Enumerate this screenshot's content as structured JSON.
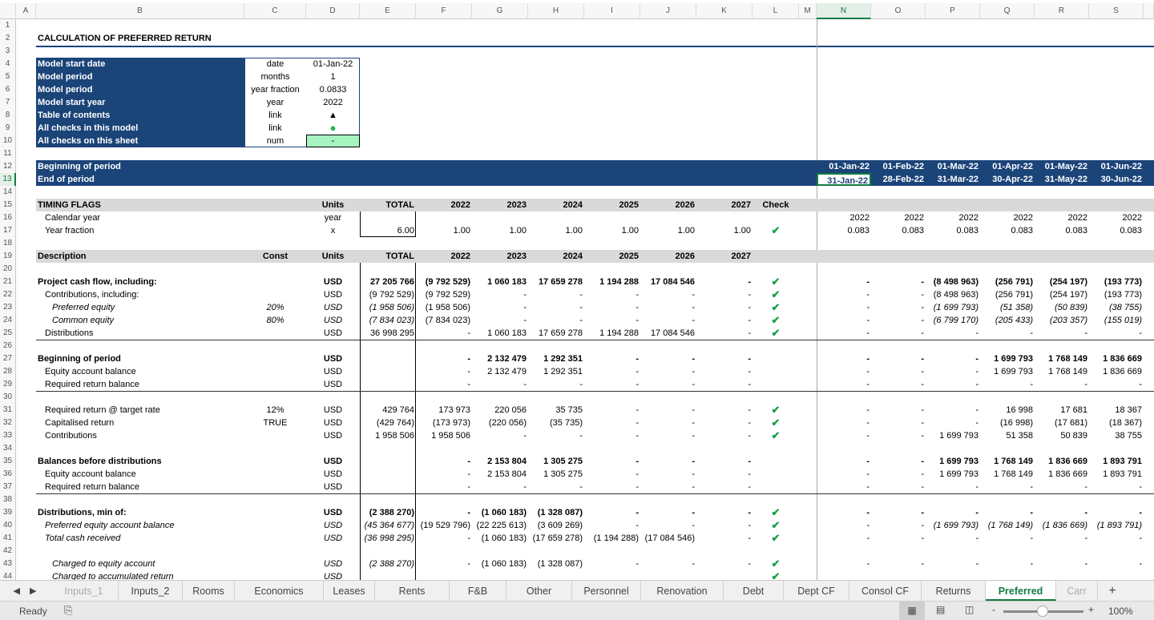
{
  "columns": [
    "A",
    "B",
    "C",
    "D",
    "E",
    "F",
    "G",
    "H",
    "I",
    "J",
    "K",
    "L",
    "M",
    "N",
    "O",
    "P",
    "Q",
    "R",
    "S"
  ],
  "selected_cell": "N13",
  "title": "CALCULATION OF PREFERRED RETURN",
  "rows": [
    {
      "r": 2,
      "cells": {
        "B": "CALCULATION OF PREFERRED RETURN"
      },
      "b": true
    },
    {
      "r": 4,
      "cells": {
        "B": "Model start date",
        "C": "date",
        "D": "01-Jan-22"
      },
      "info": true
    },
    {
      "r": 5,
      "cells": {
        "B": "Model period",
        "C": "months",
        "D": "1"
      },
      "info": true
    },
    {
      "r": 6,
      "cells": {
        "B": "Model period",
        "C": "year fraction",
        "D": "0.0833"
      },
      "info": true
    },
    {
      "r": 7,
      "cells": {
        "B": "Model start year",
        "C": "year",
        "D": "2022"
      },
      "info": true
    },
    {
      "r": 8,
      "cells": {
        "B": "Table of contents",
        "C": "link",
        "D": "▲"
      },
      "info": true
    },
    {
      "r": 9,
      "cells": {
        "B": "All checks in this model",
        "C": "link",
        "D": "●"
      },
      "info": true
    },
    {
      "r": 10,
      "cells": {
        "B": "All checks on this sheet",
        "C": "num",
        "D": "-"
      },
      "info": true
    },
    {
      "r": 12,
      "cells": {
        "B": "Beginning of period",
        "N": "01-Jan-22",
        "O": "01-Feb-22",
        "P": "01-Mar-22",
        "Q": "01-Apr-22",
        "R": "01-May-22",
        "S": "01-Jun-22"
      },
      "band": "blue",
      "b": true
    },
    {
      "r": 13,
      "cells": {
        "B": "End of period",
        "N": "31-Jan-22",
        "O": "28-Feb-22",
        "P": "31-Mar-22",
        "Q": "30-Apr-22",
        "R": "31-May-22",
        "S": "30-Jun-22"
      },
      "band": "blue",
      "b": true
    },
    {
      "r": 15,
      "cells": {
        "B": "TIMING FLAGS",
        "D": "Units",
        "E": "TOTAL",
        "F": "2022",
        "G": "2023",
        "H": "2024",
        "I": "2025",
        "J": "2026",
        "K": "2027",
        "L": "Check"
      },
      "band": "gray",
      "b": true
    },
    {
      "r": 16,
      "cells": {
        "B": "Calendar year",
        "D": "year",
        "N": "2022",
        "O": "2022",
        "P": "2022",
        "Q": "2022",
        "R": "2022",
        "S": "2022"
      },
      "indent": 1
    },
    {
      "r": 17,
      "cells": {
        "B": "Year fraction",
        "D": "x",
        "E": "6.00",
        "F": "1.00",
        "G": "1.00",
        "H": "1.00",
        "I": "1.00",
        "J": "1.00",
        "K": "1.00",
        "L": "✔",
        "N": "0.083",
        "O": "0.083",
        "P": "0.083",
        "Q": "0.083",
        "R": "0.083",
        "S": "0.083"
      },
      "indent": 1
    },
    {
      "r": 19,
      "cells": {
        "B": "Description",
        "C": "Const",
        "D": "Units",
        "E": "TOTAL",
        "F": "2022",
        "G": "2023",
        "H": "2024",
        "I": "2025",
        "J": "2026",
        "K": "2027"
      },
      "band": "gray",
      "b": true
    },
    {
      "r": 21,
      "cells": {
        "B": "Project cash flow, including:",
        "D": "USD",
        "E": "27 205 766",
        "F": "(9 792 529)",
        "G": "1 060 183",
        "H": "17 659 278",
        "I": "1 194 288",
        "J": "17 084 546",
        "K": "-",
        "L": "✔",
        "N": "-",
        "O": "-",
        "P": "(8 498 963)",
        "Q": "(256 791)",
        "R": "(254 197)",
        "S": "(193 773)"
      },
      "b": true
    },
    {
      "r": 22,
      "cells": {
        "B": "Contributions, including:",
        "D": "USD",
        "E": "(9 792 529)",
        "F": "(9 792 529)",
        "G": "-",
        "H": "-",
        "I": "-",
        "J": "-",
        "K": "-",
        "L": "✔",
        "N": "-",
        "O": "-",
        "P": "(8 498 963)",
        "Q": "(256 791)",
        "R": "(254 197)",
        "S": "(193 773)"
      },
      "indent": 1
    },
    {
      "r": 23,
      "cells": {
        "B": "Preferred equity",
        "C": "20%",
        "D": "USD",
        "E": "(1 958 506)",
        "F": "(1 958 506)",
        "G": "-",
        "H": "-",
        "I": "-",
        "J": "-",
        "K": "-",
        "L": "✔",
        "N": "-",
        "O": "-",
        "P": "(1 699 793)",
        "Q": "(51 358)",
        "R": "(50 839)",
        "S": "(38 755)"
      },
      "indent": 2,
      "i": true
    },
    {
      "r": 24,
      "cells": {
        "B": "Common equity",
        "C": "80%",
        "D": "USD",
        "E": "(7 834 023)",
        "F": "(7 834 023)",
        "G": "-",
        "H": "-",
        "I": "-",
        "J": "-",
        "K": "-",
        "L": "✔",
        "N": "-",
        "O": "-",
        "P": "(6 799 170)",
        "Q": "(205 433)",
        "R": "(203 357)",
        "S": "(155 019)"
      },
      "indent": 2,
      "i": true
    },
    {
      "r": 25,
      "cells": {
        "B": "Distributions",
        "D": "USD",
        "E": "36 998 295",
        "F": "-",
        "G": "1 060 183",
        "H": "17 659 278",
        "I": "1 194 288",
        "J": "17 084 546",
        "K": "-",
        "L": "✔",
        "N": "-",
        "O": "-",
        "P": "-",
        "Q": "-",
        "R": "-",
        "S": "-"
      },
      "indent": 1,
      "line": true
    },
    {
      "r": 27,
      "cells": {
        "B": "Beginning of period",
        "D": "USD",
        "F": "-",
        "G": "2 132 479",
        "H": "1 292 351",
        "I": "-",
        "J": "-",
        "K": "-",
        "N": "-",
        "O": "-",
        "P": "-",
        "Q": "1 699 793",
        "R": "1 768 149",
        "S": "1 836 669"
      },
      "b": true
    },
    {
      "r": 28,
      "cells": {
        "B": "Equity account balance",
        "D": "USD",
        "F": "-",
        "G": "2 132 479",
        "H": "1 292 351",
        "I": "-",
        "J": "-",
        "K": "-",
        "N": "-",
        "O": "-",
        "P": "-",
        "Q": "1 699 793",
        "R": "1 768 149",
        "S": "1 836 669"
      },
      "indent": 1
    },
    {
      "r": 29,
      "cells": {
        "B": "Required return balance",
        "D": "USD",
        "F": "-",
        "G": "-",
        "H": "-",
        "I": "-",
        "J": "-",
        "K": "-",
        "N": "-",
        "O": "-",
        "P": "-",
        "Q": "-",
        "R": "-",
        "S": "-"
      },
      "indent": 1,
      "line": true
    },
    {
      "r": 31,
      "cells": {
        "B": "Required return @ target rate",
        "C": "12%",
        "D": "USD",
        "E": "429 764",
        "F": "173 973",
        "G": "220 056",
        "H": "35 735",
        "I": "-",
        "J": "-",
        "K": "-",
        "L": "✔",
        "N": "-",
        "O": "-",
        "P": "-",
        "Q": "16 998",
        "R": "17 681",
        "S": "18 367"
      },
      "indent": 1
    },
    {
      "r": 32,
      "cells": {
        "B": "Capitalised return",
        "C": "TRUE",
        "D": "USD",
        "E": "(429 764)",
        "F": "(173 973)",
        "G": "(220 056)",
        "H": "(35 735)",
        "I": "-",
        "J": "-",
        "K": "-",
        "L": "✔",
        "N": "-",
        "O": "-",
        "P": "-",
        "Q": "(16 998)",
        "R": "(17 681)",
        "S": "(18 367)"
      },
      "indent": 1
    },
    {
      "r": 33,
      "cells": {
        "B": "Contributions",
        "D": "USD",
        "E": "1 958 506",
        "F": "1 958 506",
        "G": "-",
        "H": "-",
        "I": "-",
        "J": "-",
        "K": "-",
        "L": "✔",
        "N": "-",
        "O": "-",
        "P": "1 699 793",
        "Q": "51 358",
        "R": "50 839",
        "S": "38 755"
      },
      "indent": 1
    },
    {
      "r": 35,
      "cells": {
        "B": "Balances before distributions",
        "D": "USD",
        "F": "-",
        "G": "2 153 804",
        "H": "1 305 275",
        "I": "-",
        "J": "-",
        "K": "-",
        "N": "-",
        "O": "-",
        "P": "1 699 793",
        "Q": "1 768 149",
        "R": "1 836 669",
        "S": "1 893 791"
      },
      "b": true
    },
    {
      "r": 36,
      "cells": {
        "B": "Equity account balance",
        "D": "USD",
        "F": "-",
        "G": "2 153 804",
        "H": "1 305 275",
        "I": "-",
        "J": "-",
        "K": "-",
        "N": "-",
        "O": "-",
        "P": "1 699 793",
        "Q": "1 768 149",
        "R": "1 836 669",
        "S": "1 893 791"
      },
      "indent": 1
    },
    {
      "r": 37,
      "cells": {
        "B": "Required return balance",
        "D": "USD",
        "F": "-",
        "G": "-",
        "H": "-",
        "I": "-",
        "J": "-",
        "K": "-",
        "N": "-",
        "O": "-",
        "P": "-",
        "Q": "-",
        "R": "-",
        "S": "-"
      },
      "indent": 1,
      "line": true
    },
    {
      "r": 39,
      "cells": {
        "B": "Distributions, min of:",
        "D": "USD",
        "E": "(2 388 270)",
        "F": "-",
        "G": "(1 060 183)",
        "H": "(1 328 087)",
        "I": "-",
        "J": "-",
        "K": "-",
        "L": "✔",
        "N": "-",
        "O": "-",
        "P": "-",
        "Q": "-",
        "R": "-",
        "S": "-"
      },
      "b": true
    },
    {
      "r": 40,
      "cells": {
        "B": "Preferred equity account balance",
        "D": "USD",
        "E": "(45 364 677)",
        "F": "(19 529 796)",
        "G": "(22 225 613)",
        "H": "(3 609 269)",
        "I": "-",
        "J": "-",
        "K": "-",
        "L": "✔",
        "N": "-",
        "O": "-",
        "P": "(1 699 793)",
        "Q": "(1 768 149)",
        "R": "(1 836 669)",
        "S": "(1 893 791)"
      },
      "indent": 1,
      "i": true
    },
    {
      "r": 41,
      "cells": {
        "B": "Total cash received",
        "D": "USD",
        "E": "(36 998 295)",
        "F": "-",
        "G": "(1 060 183)",
        "H": "(17 659 278)",
        "I": "(1 194 288)",
        "J": "(17 084 546)",
        "K": "-",
        "L": "✔",
        "N": "-",
        "O": "-",
        "P": "-",
        "Q": "-",
        "R": "-",
        "S": "-"
      },
      "indent": 1,
      "i": true
    },
    {
      "r": 43,
      "cells": {
        "B": "Charged to equity account",
        "D": "USD",
        "E": "(2 388 270)",
        "F": "-",
        "G": "(1 060 183)",
        "H": "(1 328 087)",
        "I": "-",
        "J": "-",
        "K": "-",
        "L": "✔",
        "N": "-",
        "O": "-",
        "P": "-",
        "Q": "-",
        "R": "-",
        "S": "-"
      },
      "indent": 2,
      "i": true
    },
    {
      "r": 44,
      "cells": {
        "B": "Charged to accumulated return",
        "D": "USD",
        "L": "✔"
      },
      "indent": 2,
      "i": true
    }
  ],
  "sheet_tabs": [
    "Inputs_1",
    "Inputs_2",
    "Rooms",
    "Economics",
    "Leases",
    "Rents",
    "F&B",
    "Other",
    "Personnel",
    "Renovation",
    "Debt",
    "Dept CF",
    "Consol CF",
    "Returns",
    "Preferred",
    "Carr"
  ],
  "active_tab": "Preferred",
  "add_sheet": "+",
  "status": {
    "mode": "Ready",
    "zoom": "100%",
    "zoom_minus": "-",
    "zoom_plus": "+"
  },
  "colors": {
    "header_blue": "#1b4479",
    "check_green": "#1aa04a",
    "selected_green": "#107c41",
    "ok_fill": "#a6f5c0"
  }
}
